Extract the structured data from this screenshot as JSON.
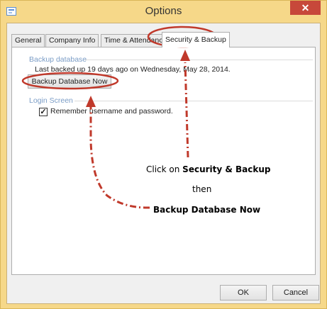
{
  "window": {
    "title": "Options",
    "close_symbol": "✕"
  },
  "tabs": [
    {
      "label": "General"
    },
    {
      "label": "Company Info"
    },
    {
      "label": "Time & Attendance"
    },
    {
      "label": "Security & Backup"
    }
  ],
  "backup": {
    "group_label": "Backup database",
    "last_backup_text": "Last backed up 19 days ago on Wednesday, May 28, 2014.",
    "button_label": "Backup Database Now"
  },
  "login": {
    "group_label": "Login Screen",
    "remember_checked": true,
    "remember_label": "Remember username and password."
  },
  "annotations": {
    "step1_prefix": "Click on ",
    "step1_bold": "Security & Backup",
    "then": "then",
    "step2_bold": "Backup Database Now"
  },
  "footer": {
    "ok_label": "OK",
    "cancel_label": "Cancel"
  },
  "colors": {
    "annotation_red": "#c0392b",
    "close_red": "#c7483a",
    "frame_gold": "#f6d889",
    "group_blue": "#7a9cc6"
  },
  "icons": {
    "app": "document-icon",
    "close": "close-icon",
    "check": "checkmark-icon"
  }
}
